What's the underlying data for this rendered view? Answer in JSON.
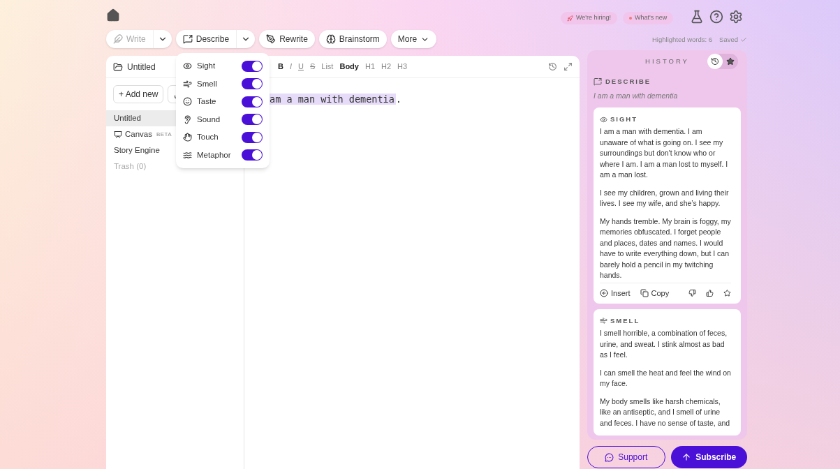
{
  "top_bar": {
    "badges": [
      {
        "kind": "hiring",
        "label": "We're hiring!"
      },
      {
        "kind": "news",
        "label": "What's new"
      }
    ]
  },
  "toolbar": {
    "buttons": [
      {
        "label": "Write",
        "kind": "write",
        "disabled": true,
        "dropdown": true
      },
      {
        "label": "Describe",
        "kind": "describe",
        "disabled": false,
        "dropdown": true
      },
      {
        "label": "Rewrite",
        "kind": "rewrite",
        "disabled": false,
        "dropdown": false
      },
      {
        "label": "Brainstorm",
        "kind": "brainstorm",
        "disabled": false,
        "dropdown": false
      },
      {
        "label": "More",
        "kind": "more",
        "disabled": false,
        "dropdown": false
      }
    ]
  },
  "status": {
    "highlighted": "Highlighted words: 6",
    "saved": "Saved"
  },
  "sidebar": {
    "doc_title": "Untitled",
    "add_new": "+ Add new",
    "items": [
      {
        "label": "Untitled",
        "kind": "doc",
        "selected": true,
        "disabled": false
      },
      {
        "label": "Canvas",
        "kind": "canvas",
        "badge": "BETA",
        "selected": false,
        "disabled": false
      },
      {
        "label": "Story Engine",
        "kind": "doc",
        "selected": false,
        "disabled": false
      },
      {
        "label": "Trash (0)",
        "kind": "doc",
        "selected": false,
        "disabled": true
      }
    ]
  },
  "format_bar": [
    {
      "label": "B",
      "kind": "bold"
    },
    {
      "label": "I",
      "kind": "italic"
    },
    {
      "label": "U",
      "kind": "underline"
    },
    {
      "label": "S",
      "kind": "strike"
    },
    {
      "label": "List",
      "kind": "plain"
    },
    {
      "label": "Body",
      "kind": "active"
    },
    {
      "label": "H1",
      "kind": "plain"
    },
    {
      "label": "H2",
      "kind": "plain"
    },
    {
      "label": "H3",
      "kind": "plain"
    }
  ],
  "editor": {
    "highlighted": "am a man with dementia",
    "rest": "."
  },
  "senses_menu": [
    {
      "label": "Sight",
      "kind": "sight",
      "on": true
    },
    {
      "label": "Smell",
      "kind": "smell",
      "on": true
    },
    {
      "label": "Taste",
      "kind": "taste",
      "on": true
    },
    {
      "label": "Sound",
      "kind": "sound",
      "on": true
    },
    {
      "label": "Touch",
      "kind": "touch",
      "on": true
    },
    {
      "label": "Metaphor",
      "kind": "metaphor",
      "on": true
    }
  ],
  "history": {
    "title": "HISTORY",
    "tabs": [
      {
        "kind": "recent",
        "selected": true
      },
      {
        "kind": "starred",
        "selected": false
      }
    ],
    "section": "DESCRIBE",
    "prompt": "I am a man with dementia",
    "cards": [
      {
        "kind": "sight",
        "title": "SIGHT",
        "paragraphs": [
          "I am a man with dementia. I am unaware of what is going on. I see my surroundings but don't know who or where I am. I am a man lost to myself. I am a man lost.",
          "I see my children, grown and living their lives. I see my wife, and she’s happy.",
          "My hands tremble. My brain is foggy, my memories obfuscated. I forget people and places, dates and names. I would have to write everything down, but I can barely hold a pencil in my twitching hands."
        ],
        "actions": [
          "Insert",
          "Copy"
        ]
      },
      {
        "kind": "smell",
        "title": "SMELL",
        "paragraphs": [
          "I smell horrible, a combination of feces, urine, and sweat. I stink almost as bad as I feel.",
          "I can smell the heat and feel the wind on my face.",
          "My body smells like harsh chemicals, like an antiseptic, and I smell of urine and feces. I have no sense of taste, and"
        ]
      }
    ]
  },
  "footer": {
    "support": "Support",
    "subscribe": "Subscribe"
  }
}
